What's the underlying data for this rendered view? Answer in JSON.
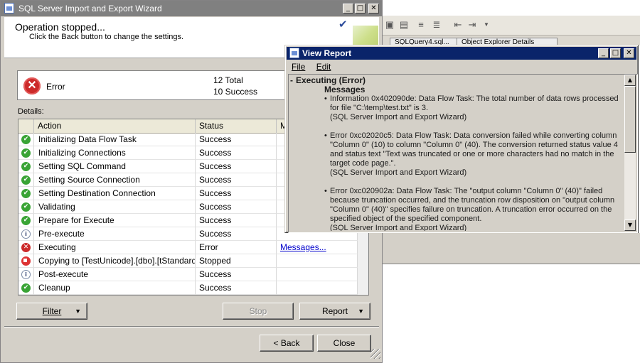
{
  "background": {
    "tabs": [
      "SQLQuery4.sql...",
      "Object Explorer Details"
    ]
  },
  "wizard": {
    "title": "SQL Server Import and Export Wizard",
    "heading": "Operation stopped...",
    "subheading": "Click the Back button to change the settings.",
    "summary": {
      "label": "Error",
      "total": "12 Total",
      "success": "10 Success"
    },
    "details_label": "Details:",
    "columns": [
      "Action",
      "Status",
      "M"
    ],
    "rows": [
      {
        "icon": "success",
        "action": "Initializing Data Flow Task",
        "status": "Success",
        "message": ""
      },
      {
        "icon": "success",
        "action": "Initializing Connections",
        "status": "Success",
        "message": ""
      },
      {
        "icon": "success",
        "action": "Setting SQL Command",
        "status": "Success",
        "message": ""
      },
      {
        "icon": "success",
        "action": "Setting Source Connection",
        "status": "Success",
        "message": ""
      },
      {
        "icon": "success",
        "action": "Setting Destination Connection",
        "status": "Success",
        "message": ""
      },
      {
        "icon": "success",
        "action": "Validating",
        "status": "Success",
        "message": ""
      },
      {
        "icon": "success",
        "action": "Prepare for Execute",
        "status": "Success",
        "message": ""
      },
      {
        "icon": "info",
        "action": "Pre-execute",
        "status": "Success",
        "message": ""
      },
      {
        "icon": "error",
        "action": "Executing",
        "status": "Error",
        "message": "Messages..."
      },
      {
        "icon": "stopped",
        "action": "Copying to [TestUnicode].[dbo].[tStandard]",
        "status": "Stopped",
        "message": ""
      },
      {
        "icon": "info",
        "action": "Post-execute",
        "status": "Success",
        "message": ""
      },
      {
        "icon": "success",
        "action": "Cleanup",
        "status": "Success",
        "message": ""
      }
    ],
    "buttons": {
      "filter": "Filter",
      "stop": "Stop",
      "report": "Report",
      "back": "< Back",
      "close": "Close"
    }
  },
  "report": {
    "title": "View Report",
    "menu": [
      "File",
      "Edit"
    ],
    "heading": "Executing (Error)",
    "messages_heading": "Messages",
    "messages": [
      {
        "text": "Information 0x402090de: Data Flow Task: The total number of data rows processed for file \"C:\\temp\\test.txt\" is 3.",
        "source": "(SQL Server Import and Export Wizard)"
      },
      {
        "text": "Error 0xc02020c5: Data Flow Task: Data conversion failed while converting column \"Column 0\" (10) to column \"Column 0\" (40).  The conversion returned status value 4 and status text \"Text was truncated or one or more characters had no match in the target code page.\".",
        "source": "(SQL Server Import and Export Wizard)"
      },
      {
        "text": "Error 0xc020902a: Data Flow Task: The \"output column \"Column 0\" (40)\" failed because truncation occurred, and the truncation row disposition on \"output column \"Column 0\" (40)\" specifies failure on truncation. A truncation error occurred on the specified object of the specified component.",
        "source": "(SQL Server Import and Export Wizard)"
      }
    ]
  }
}
